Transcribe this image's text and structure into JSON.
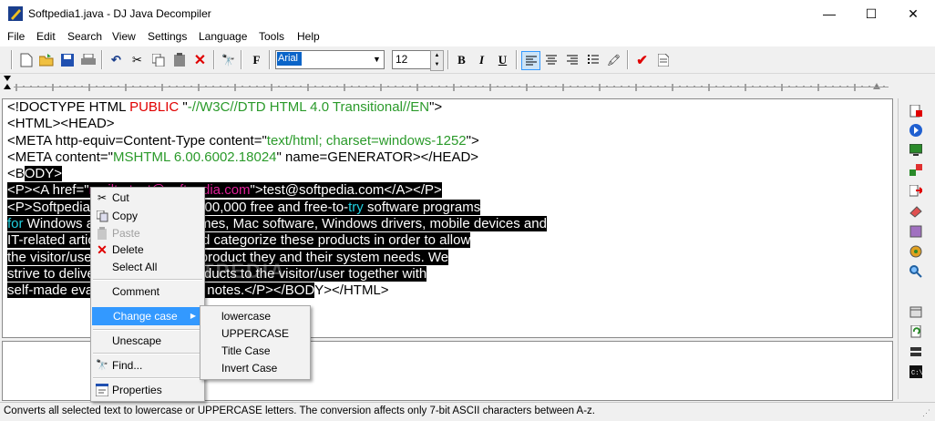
{
  "window": {
    "title": "Softpedia1.java - DJ Java Decompiler",
    "minimize": "—",
    "maximize": "☐",
    "close": "✕"
  },
  "menu": [
    "File",
    "Edit",
    "Search",
    "View",
    "Settings",
    "Language",
    "Tools",
    "Help"
  ],
  "toolbar": {
    "font_name": "Arial",
    "font_size": "12",
    "bold": "B",
    "italic": "I",
    "underline": "U",
    "font_button": "F"
  },
  "code_lines": [
    [
      {
        "t": "<!DOCTYPE HTML "
      },
      {
        "t": "PUBLIC",
        "c": "red"
      },
      {
        "t": " \""
      },
      {
        "t": "-//W3C//DTD HTML 4.0 Transitional//EN",
        "c": "green"
      },
      {
        "t": "\">"
      }
    ],
    [
      {
        "t": "<HTML><HEAD>"
      }
    ],
    [
      {
        "t": "<META http-equiv=Content-Type content=\""
      },
      {
        "t": "text/html; charset=windows-1252",
        "c": "green"
      },
      {
        "t": "\">"
      }
    ],
    [
      {
        "t": "<META content=\""
      },
      {
        "t": "MSHTML 6.00.6002.18024",
        "c": "green"
      },
      {
        "t": "\" name=GENERATOR></HEAD>"
      }
    ],
    [
      {
        "t": "<B"
      },
      {
        "t": "ODY>",
        "h": 1
      }
    ],
    [
      {
        "t": "<P><A href=\"",
        "h": 1
      },
      {
        "t": "mailto:test@softpedia.com",
        "h": 1,
        "c": "mag"
      },
      {
        "t": "\">test@softpedia.com</A></P>",
        "h": 1
      }
    ],
    [
      {
        "t": "<P>Softpedia offers more than 400,000 free and free-to-",
        "h": 1
      },
      {
        "t": "try",
        "h": 1,
        "c": "cyan"
      },
      {
        "t": " software programs",
        "h": 1
      }
    ],
    [
      {
        "t": "for",
        "h": 1,
        "c": "cyan"
      },
      {
        "t": " Windows and Unix/Linux, games, Mac software, Windows drivers, mobile devices and",
        "h": 1
      }
    ],
    [
      {
        "t": "IT-related articles. We review and categorize these products in order to allow",
        "h": 1
      }
    ],
    [
      {
        "t": "the visitor/user to find the exact product they and their system needs. We",
        "h": 1
      }
    ],
    [
      {
        "t": "strive to deliver only the best products to the visitor/user together with",
        "h": 1
      }
    ],
    [
      {
        "t": "self-made evaluation and review notes.</P></BOD",
        "h": 1
      },
      {
        "t": "Y></HTML>"
      }
    ]
  ],
  "context_menu": {
    "cut": "Cut",
    "copy": "Copy",
    "paste": "Paste",
    "delete": "Delete",
    "select_all": "Select All",
    "comment": "Comment",
    "change_case": "Change case",
    "unescape": "Unescape",
    "find": "Find...",
    "properties": "Properties"
  },
  "submenu": {
    "lowercase": "lowercase",
    "uppercase": "UPPERCASE",
    "title_case": "Title Case",
    "invert_case": "Invert Case"
  },
  "status": "Converts all selected text to lowercase or UPPERCASE letters. The conversion affects only 7-bit ASCII characters between A-z.",
  "colors": {
    "selection": "#000000",
    "keyword": "#e00000",
    "string": "#2a9a2a",
    "link": "#e0209a",
    "highlight": "#20d0e0",
    "menu_active": "#3399ff"
  }
}
